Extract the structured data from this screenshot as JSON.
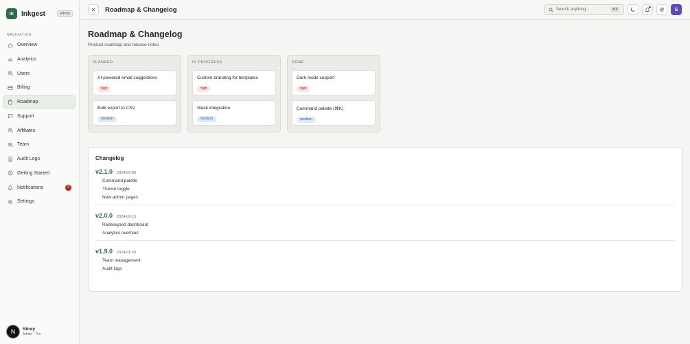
{
  "brand": {
    "logo": "IK",
    "name": "Inkgest",
    "badge": "admin"
  },
  "sidebar": {
    "heading": "NAVIGATION",
    "items": [
      {
        "label": "Overview",
        "icon": "home-icon"
      },
      {
        "label": "Analytics",
        "icon": "bar-chart-icon"
      },
      {
        "label": "Users",
        "icon": "users-icon"
      },
      {
        "label": "Billing",
        "icon": "credit-card-icon"
      },
      {
        "label": "Roadmap",
        "icon": "clipboard-icon",
        "active": true
      },
      {
        "label": "Support",
        "icon": "message-icon"
      },
      {
        "label": "Affiliates",
        "icon": "users-icon"
      },
      {
        "label": "Team",
        "icon": "users-icon"
      },
      {
        "label": "Audit Logs",
        "icon": "file-icon"
      },
      {
        "label": "Getting Started",
        "icon": "clock-icon"
      },
      {
        "label": "Notifications",
        "icon": "bell-icon",
        "badge": "3"
      },
      {
        "label": "Settings",
        "icon": "gear-icon"
      }
    ]
  },
  "user": {
    "initial": "N",
    "name": "Shrey",
    "role": "Admin · Pro"
  },
  "topbar": {
    "title": "Roadmap & Changelog",
    "search_placeholder": "Search anything...",
    "shortcut": "⌘K",
    "avatar": "S"
  },
  "page": {
    "title": "Roadmap & Changelog",
    "subtitle": "Product roadmap and release notes"
  },
  "board": [
    {
      "title": "PLANNED",
      "cards": [
        {
          "title": "AI-powered email suggestions",
          "priority": "high"
        },
        {
          "title": "Bulk export to CSV",
          "priority": "medium"
        }
      ]
    },
    {
      "title": "IN PROGRESS",
      "cards": [
        {
          "title": "Custom branding for templates",
          "priority": "high"
        },
        {
          "title": "Slack integration",
          "priority": "medium"
        }
      ]
    },
    {
      "title": "DONE",
      "cards": [
        {
          "title": "Dark mode support",
          "priority": "high"
        },
        {
          "title": "Command palette (⌘K)",
          "priority": "medium"
        }
      ]
    }
  ],
  "changelog": {
    "title": "Changelog",
    "releases": [
      {
        "version": "v2.1.0",
        "date": "2024-03-06",
        "changes": [
          "Command palette",
          "Theme toggle",
          "New admin pages"
        ]
      },
      {
        "version": "v2.0.0",
        "date": "2024-02-15",
        "changes": [
          "Redesigned dashboard",
          "Analytics overhaul"
        ]
      },
      {
        "version": "v1.9.0",
        "date": "2024-01-20",
        "changes": [
          "Team management",
          "Audit logs"
        ]
      }
    ]
  },
  "colors": {
    "brand": "#2d6a4f",
    "high": "#b42318",
    "medium": "#2f5f8f",
    "avatar": "#5b4bb7"
  }
}
